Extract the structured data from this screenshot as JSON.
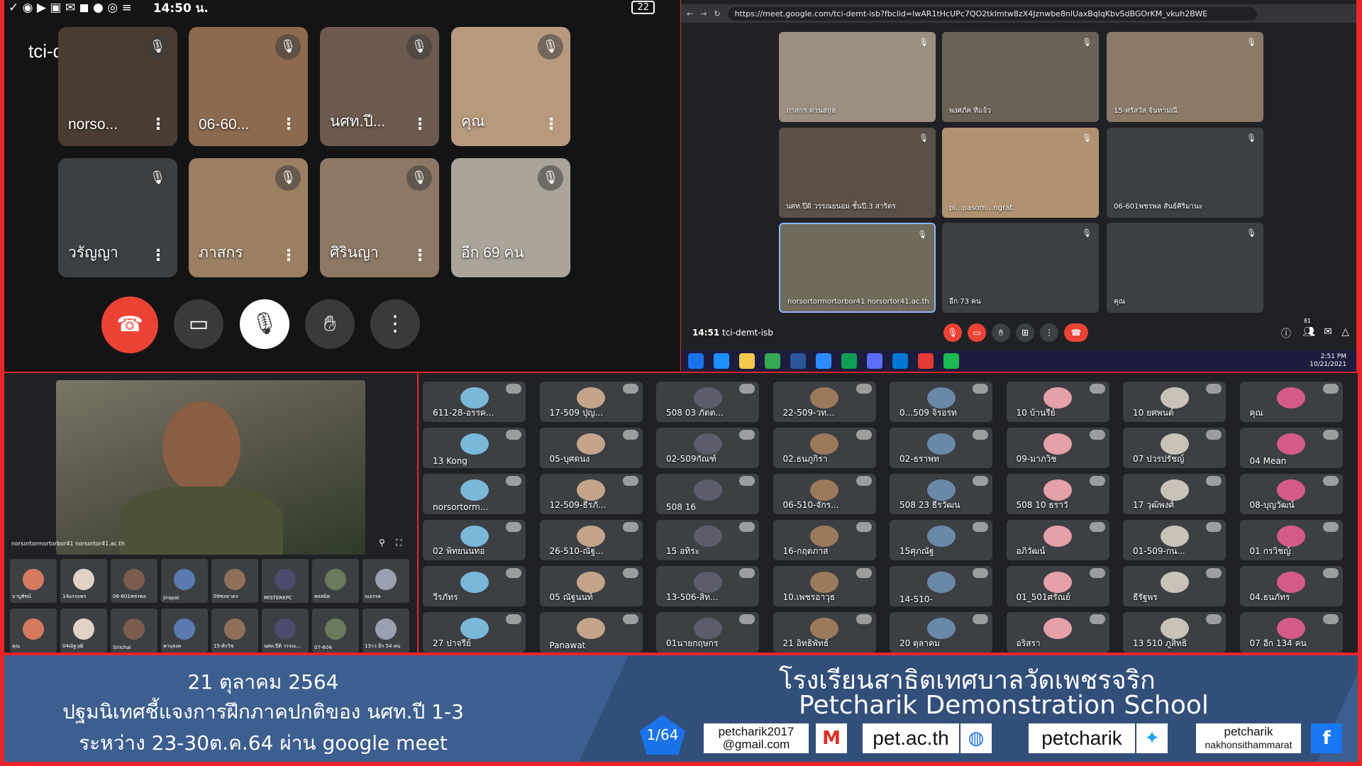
{
  "phone": {
    "clock": "14:50 น.",
    "battery": "22",
    "meeting_name": "tci-demt-isb",
    "tiles": [
      {
        "name": "norso...",
        "color": "#4a3c33"
      },
      {
        "name": "06-60...",
        "color": "#8c6a4f"
      },
      {
        "name": "นศท.ปี...",
        "color": "#6b5a4d"
      },
      {
        "name": "คุณ",
        "color": "#b79a7e"
      },
      {
        "name": "วรัญญา",
        "color": "#3c4043"
      },
      {
        "name": "ภาสกร",
        "color": "#9a7f62"
      },
      {
        "name": "ศิรินญา",
        "color": "#8d7865"
      },
      {
        "name": "อีก 69 คน",
        "color": "#aaa49a"
      }
    ],
    "partial_name": "0(",
    "more_label": "อีก 69 คน"
  },
  "browser": {
    "url": "https://meet.google.com/tci-demt-isb?fbclid=IwAR1tHcUPc7QO2tklmtw8zX4Jznwbe8nlUaxBqlqKbvSdBGOrKM_vkuh2BWE",
    "tiles": [
      {
        "name": "ภาสกร ด่านสกุล",
        "color": "#9a8f80"
      },
      {
        "name": "พงศภัค ทีแจ้ว",
        "color": "#6a6257"
      },
      {
        "name": "15-ศรัสวัส จันทามณี",
        "color": "#8a7a68"
      },
      {
        "name": "นศท.ปีดิ วรรณยนอม ชั้นปี.3 สาริตร",
        "color": "#5a5048"
      },
      {
        "name": "pi...pasorn...ngrat",
        "color": "#b09272"
      },
      {
        "name": "06-601พชรพล สันธ์ศิริมานะ",
        "color": "#3c4043"
      },
      {
        "name": "norsortormortorbor41 norsortor41.ac.th",
        "color": "#6f6a5a"
      },
      {
        "name": "อีก 73 คน",
        "color": "#3c4043"
      },
      {
        "name": "คุณ",
        "color": "#3c4043"
      }
    ],
    "time": "14:51",
    "meeting_name": "tci-demt-isb",
    "people_count": "81",
    "taskbar_time": "2:51 PM",
    "taskbar_date": "10/21/2021"
  },
  "lower_left": {
    "main_name": "norsortormortorbor41 norsortor41.ac.th",
    "minis": [
      "บาบูพัชน์",
      "14อรรถพร",
      "06-601พชรพล",
      "Jirapat",
      "09ชลธาดร",
      "MISTERKPC",
      "พลสมิต",
      "ณอรรค",
      "คุณ",
      "04ณัฐวุฒิ",
      "Sirichai",
      "พาบุลงค",
      "15-ศิรวิช",
      "นศท.ปีดิ วรรณ...",
      "07-604",
      "13วว อีก 54 คน"
    ]
  },
  "grid": {
    "tiles": [
      "611-28-อรรค...",
      "17-509 ปุญ...",
      "508 03 ภัตต...",
      "22-509-วท...",
      "0...509 จิรอรท",
      "10 บ้านรีย์",
      "10 ยศพนต์",
      "คุณ",
      "13 Kong",
      "05-บุศดนง",
      "02-509กัณฑ์",
      "02.ธนภูกิรา",
      "02-ธราพท",
      "09-มาภวิช",
      "07 ปวรปรัชญ์",
      "04 Mean",
      "norsortorm...",
      "12-509-ธีรภั...",
      "508 16",
      "06-510-จักร...",
      "508 23 ธีรวัฒน",
      "508 10 ธราวั",
      "17 วุฒิพงศ์",
      "08-บุญวัฒน์",
      "02 พิทยนนทอ",
      "26-510-ณัฐ...",
      "15 อทิระ",
      "16-กฤตภาส",
      "15ศุภณัฐ",
      "อภิวัฒน์",
      "01-509-กน...",
      "01 กรวิชญ์",
      "วีรภัทร",
      "05 ณัฐนนท์",
      "13-506-สิท...",
      "10.เพชรอาวุธ",
      "14-510-",
      "01_501ศรัณย์",
      "ธีรัฐพร",
      "04.ธนภัทร",
      "27 ปาจรีย์",
      "Panawat",
      "01นายกฤษกร",
      "21 อิทธิพัทธ์",
      "20 ตุลาคม",
      "อริสรา",
      "13 510 ภูสิทธิ",
      "07 อีก 134 คน"
    ]
  },
  "footer": {
    "date": "21 ตุลาคม 2564",
    "title": "ปฐมนิเทศชี้แจงการฝึกภาคปกติของ นศท.ปี 1-3",
    "period": "ระหว่าง 23-30ต.ค.64 ผ่าน google meet",
    "school_th": "โรงเรียนสาธิตเทศบาลวัดเพชรจริก",
    "school_en": "Petcharik Demonstration School",
    "badge": "1/64",
    "email_line1": "petcharik2017",
    "email_line2": "@gmail.com",
    "website": "pet.ac.th",
    "twitter": "petcharik",
    "facebook_line1": "petcharik",
    "facebook_line2": "nakhonsithammarat"
  },
  "colors": {
    "frame": "#e8262a",
    "footer": "#3d5f8f",
    "end_call": "#ea4335",
    "meet_bg": "#202124"
  }
}
